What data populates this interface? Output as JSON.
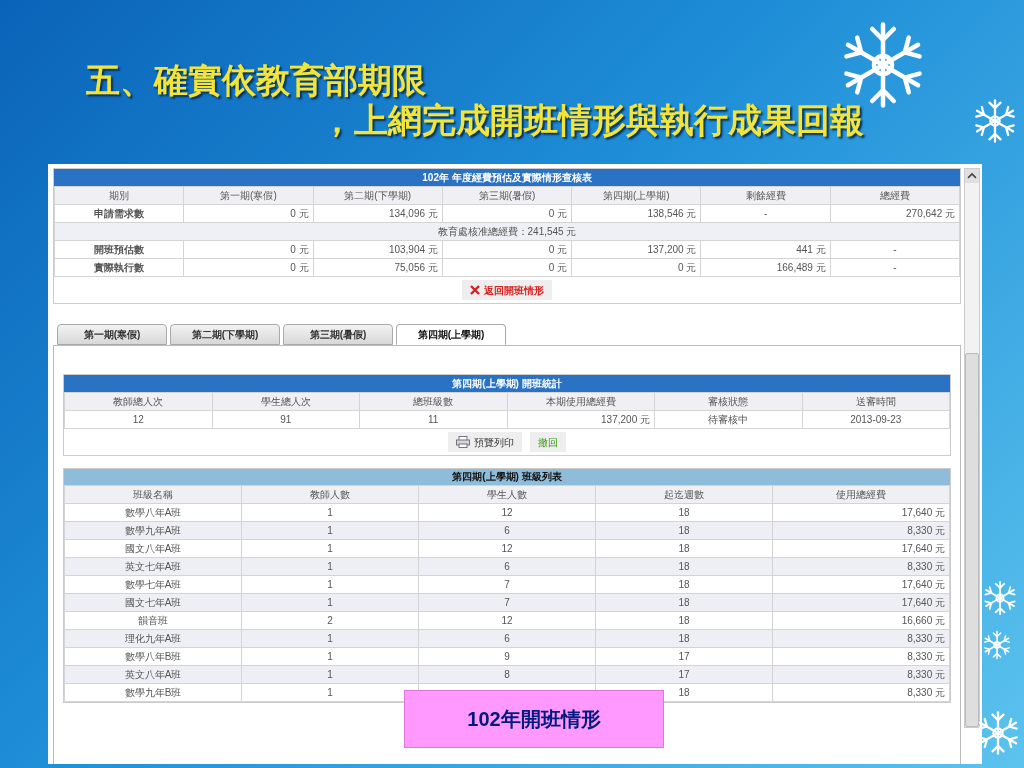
{
  "slide": {
    "title_lines": [
      "五、確實依教育部期限",
      "，上網完成開班情形與執行成果回報"
    ],
    "caption": "102年開班情形"
  },
  "summary": {
    "title": "102年 年度經費預估及實際情形查核表",
    "columns": [
      "期別",
      "第一期(寒假)",
      "第二期(下學期)",
      "第三期(暑假)",
      "第四期(上學期)",
      "剩餘經費",
      "總經費"
    ],
    "rows": [
      {
        "kind": "data",
        "label": "申請需求數",
        "cells": [
          {
            "kind": "amount",
            "text": "0 元"
          },
          {
            "kind": "amount",
            "text": "134,096 元"
          },
          {
            "kind": "amount",
            "text": "0 元"
          },
          {
            "kind": "amount",
            "text": "138,546 元"
          },
          {
            "kind": "empty",
            "text": "-"
          },
          {
            "kind": "amount",
            "text": "270,642 元"
          }
        ]
      },
      {
        "kind": "note",
        "text": "教育處核准總經費：241,545 元"
      },
      {
        "kind": "data",
        "label": "開班預估數",
        "cells": [
          {
            "kind": "amount",
            "text": "0 元"
          },
          {
            "kind": "amount",
            "text": "103,904 元"
          },
          {
            "kind": "amount",
            "text": "0 元"
          },
          {
            "kind": "amount",
            "text": "137,200 元"
          },
          {
            "kind": "amount",
            "text": "441 元"
          },
          {
            "kind": "empty",
            "text": "-"
          }
        ]
      },
      {
        "kind": "data",
        "label": "實際執行數",
        "cells": [
          {
            "kind": "amount",
            "text": "0 元"
          },
          {
            "kind": "amount",
            "text": "75,056 元"
          },
          {
            "kind": "amount",
            "text": "0 元"
          },
          {
            "kind": "amount",
            "text": "0 元"
          },
          {
            "kind": "amount",
            "text": "166,489 元"
          },
          {
            "kind": "empty",
            "text": "-"
          }
        ]
      }
    ],
    "return_button": "返回開班情形"
  },
  "tabs": [
    {
      "label": "第一期(寒假)",
      "selected": false
    },
    {
      "label": "第二期(下學期)",
      "selected": false
    },
    {
      "label": "第三期(暑假)",
      "selected": false
    },
    {
      "label": "第四期(上學期)",
      "selected": true
    }
  ],
  "stats": {
    "title": "第四期(上學期) 開班統計",
    "columns": [
      "教師總人次",
      "學生總人次",
      "總班級數",
      "本期使用總經費",
      "審核狀態",
      "送審時間"
    ],
    "values": [
      {
        "kind": "number",
        "text": "12"
      },
      {
        "kind": "number",
        "text": "91"
      },
      {
        "kind": "number",
        "text": "11"
      },
      {
        "kind": "amount",
        "text": "137,200 元"
      },
      {
        "kind": "status",
        "text": "待審核中"
      },
      {
        "kind": "number",
        "text": "2013-09-23"
      }
    ],
    "buttons": [
      {
        "kind": "print",
        "label": "預覽列印"
      },
      {
        "kind": "withdraw",
        "label": "撤回"
      }
    ]
  },
  "class_list": {
    "title": "第四期(上學期) 班級列表",
    "columns": [
      "班級名稱",
      "教師人數",
      "學生人數",
      "起迄週數",
      "使用總經費"
    ],
    "rows": [
      [
        "數學八年A班",
        "1",
        "12",
        "18",
        "17,640 元"
      ],
      [
        "數學九年A班",
        "1",
        "6",
        "18",
        "8,330 元"
      ],
      [
        "國文八年A班",
        "1",
        "12",
        "18",
        "17,640 元"
      ],
      [
        "英文七年A班",
        "1",
        "6",
        "18",
        "8,330 元"
      ],
      [
        "數學七年A班",
        "1",
        "7",
        "18",
        "17,640 元"
      ],
      [
        "國文七年A班",
        "1",
        "7",
        "18",
        "17,640 元"
      ],
      [
        "韻音班",
        "2",
        "12",
        "18",
        "16,660 元"
      ],
      [
        "理化九年A班",
        "1",
        "6",
        "18",
        "8,330 元"
      ],
      [
        "數學八年B班",
        "1",
        "9",
        "17",
        "8,330 元"
      ],
      [
        "英文八年A班",
        "1",
        "8",
        "17",
        "8,330 元"
      ],
      [
        "數學九年B班",
        "1",
        null,
        "18",
        "8,330 元"
      ]
    ]
  }
}
